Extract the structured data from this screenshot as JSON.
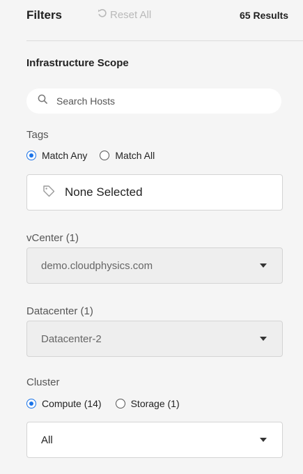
{
  "header": {
    "title": "Filters",
    "reset_label": "Reset All",
    "results": "65 Results"
  },
  "scope": {
    "title": "Infrastructure Scope",
    "search_placeholder": "Search Hosts"
  },
  "tags": {
    "label": "Tags",
    "options": [
      {
        "label": "Match Any",
        "checked": true
      },
      {
        "label": "Match All",
        "checked": false
      }
    ],
    "selector_text": "None Selected"
  },
  "vcenter": {
    "label": "vCenter (1)",
    "value": "demo.cloudphysics.com"
  },
  "datacenter": {
    "label": "Datacenter (1)",
    "value": "Datacenter-2"
  },
  "cluster": {
    "label": "Cluster",
    "options": [
      {
        "label": "Compute (14)",
        "checked": true
      },
      {
        "label": "Storage (1)",
        "checked": false
      }
    ],
    "value": "All"
  },
  "colors": {
    "accent": "#1a73e8",
    "disabled_text": "#b9b9b9"
  }
}
